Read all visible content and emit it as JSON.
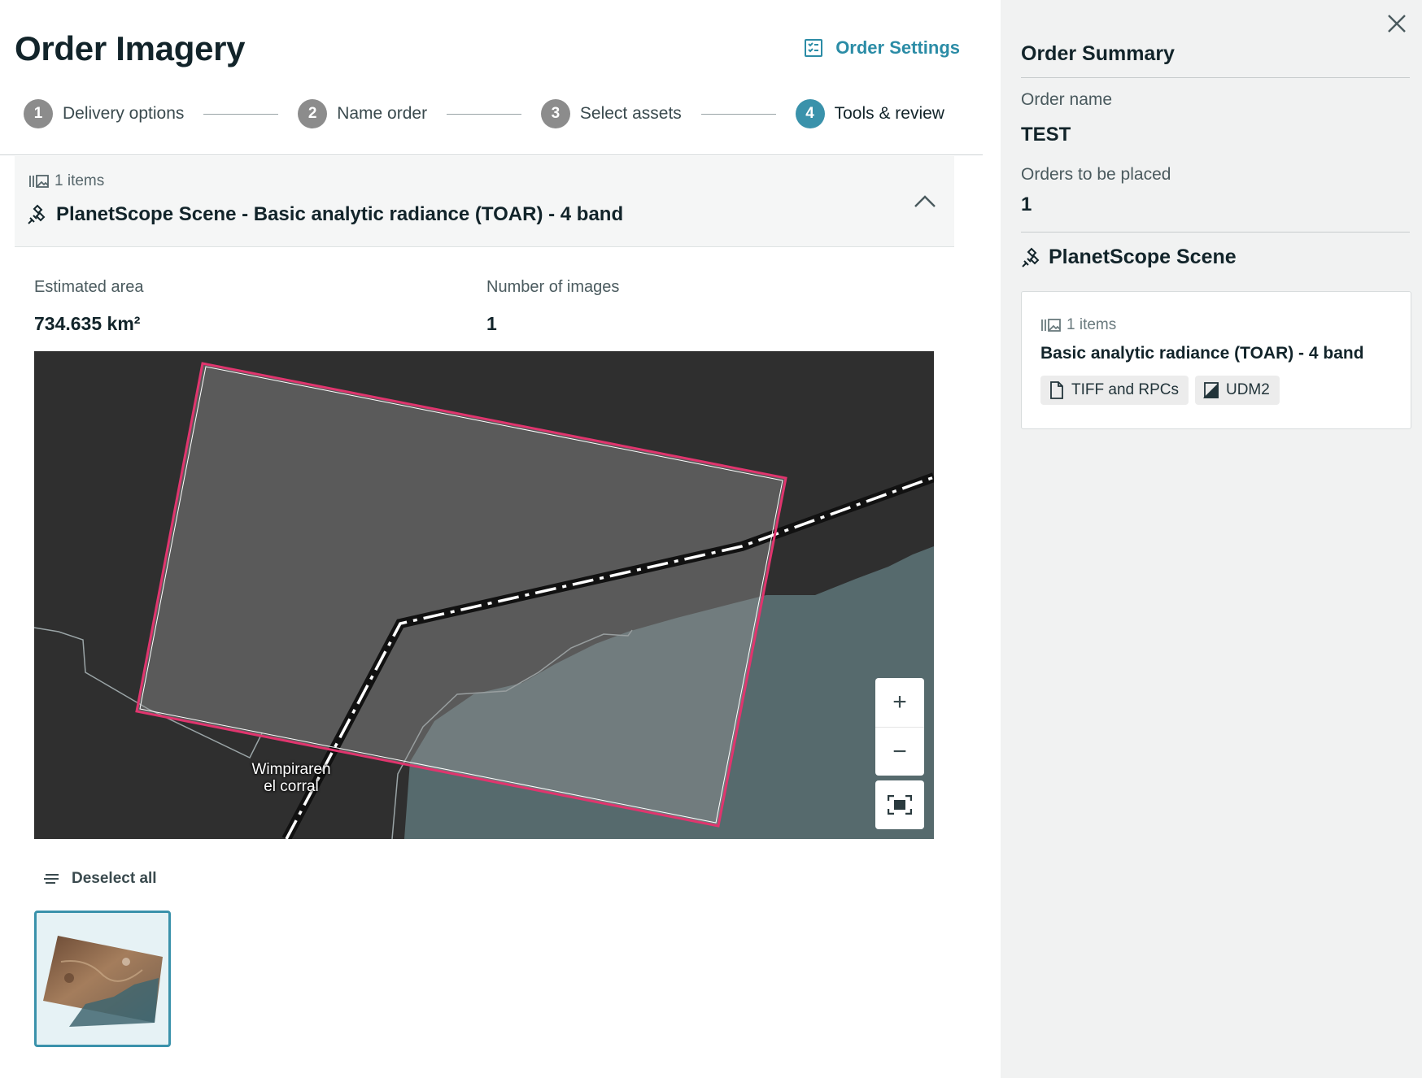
{
  "header": {
    "title": "Order Imagery",
    "settings_label": "Order Settings"
  },
  "stepper": {
    "steps": [
      {
        "num": "1",
        "label": "Delivery options",
        "state": "inactive"
      },
      {
        "num": "2",
        "label": "Name order",
        "state": "inactive"
      },
      {
        "num": "3",
        "label": "Select assets",
        "state": "inactive"
      },
      {
        "num": "4",
        "label": "Tools & review",
        "state": "active"
      }
    ]
  },
  "item_group": {
    "count_label": "1 items",
    "title": "PlanetScope Scene - Basic analytic radiance (TOAR) - 4 band",
    "expanded": true
  },
  "stats": {
    "area_label": "Estimated area",
    "area_value": "734.635 km²",
    "images_label": "Number of images",
    "images_value": "1"
  },
  "map": {
    "place_label_line1": "Wimpiraren",
    "place_label_line2": "el corral",
    "zoom_in": "+",
    "zoom_out": "−",
    "footprint_color": "#e0356e",
    "land_color": "#2f2f2f",
    "water_color": "#566a6d"
  },
  "selection": {
    "deselect_label": "Deselect all"
  },
  "summary": {
    "title": "Order Summary",
    "order_name_label": "Order name",
    "order_name_value": "TEST",
    "orders_label": "Orders to be placed",
    "orders_value": "1",
    "product_title": "PlanetScope Scene",
    "card": {
      "count_label": "1 items",
      "bundle_title": "Basic analytic radiance (TOAR) - 4 band",
      "assets": [
        {
          "icon": "file-icon",
          "label": "TIFF and RPCs"
        },
        {
          "icon": "mask-icon",
          "label": "UDM2"
        }
      ]
    }
  },
  "colors": {
    "accent": "#3a92ab",
    "link": "#2b8ca6",
    "step_inactive": "#8c8c8c",
    "panel_bg": "#f1f2f2"
  }
}
